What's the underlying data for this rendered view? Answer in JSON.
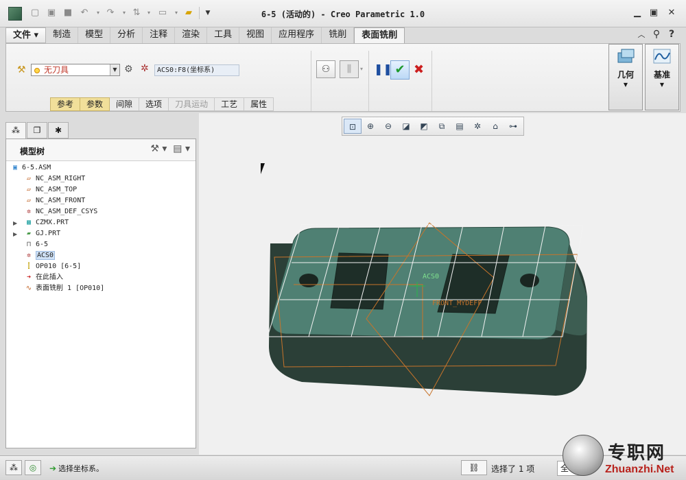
{
  "window": {
    "title": "6-5 (活动的) - Creo Parametric 1.0"
  },
  "ribbon_tabs": [
    {
      "label": "文件 ▾",
      "name": "tab-file"
    },
    {
      "label": "制造",
      "name": "tab-manufacture"
    },
    {
      "label": "模型",
      "name": "tab-model"
    },
    {
      "label": "分析",
      "name": "tab-analysis"
    },
    {
      "label": "注释",
      "name": "tab-annotate"
    },
    {
      "label": "渲染",
      "name": "tab-render"
    },
    {
      "label": "工具",
      "name": "tab-tools"
    },
    {
      "label": "视图",
      "name": "tab-view"
    },
    {
      "label": "应用程序",
      "name": "tab-applications"
    },
    {
      "label": "铣削",
      "name": "tab-milling"
    },
    {
      "label": "表面铣削",
      "name": "tab-face-milling"
    }
  ],
  "toolbar": {
    "tool_value": "无刀具",
    "coord_value": "ACS0:F8(坐标系)"
  },
  "subtabs": [
    {
      "label": "参考",
      "state": "hl"
    },
    {
      "label": "参数",
      "state": "hl"
    },
    {
      "label": "间隙",
      "state": "normal"
    },
    {
      "label": "选项",
      "state": "normal"
    },
    {
      "label": "刀具运动",
      "state": "disabled"
    },
    {
      "label": "工艺",
      "state": "normal"
    },
    {
      "label": "属性",
      "state": "normal"
    }
  ],
  "ribbon_groups": {
    "geometry_label": "几何",
    "datum_label": "基准"
  },
  "model_tree": {
    "title": "模型树",
    "items": [
      {
        "label": "6-5.ASM",
        "icon": "assembly-icon"
      },
      {
        "label": "NC_ASM_RIGHT",
        "icon": "datum-plane-icon"
      },
      {
        "label": "NC_ASM_TOP",
        "icon": "datum-plane-icon"
      },
      {
        "label": "NC_ASM_FRONT",
        "icon": "datum-plane-icon"
      },
      {
        "label": "NC_ASM_DEF_CSYS",
        "icon": "csys-icon"
      },
      {
        "label": "CZMX.PRT",
        "icon": "part-icon"
      },
      {
        "label": "GJ.PRT",
        "icon": "workpiece-icon"
      },
      {
        "label": "6-5",
        "icon": "workcell-icon"
      },
      {
        "label": "ACS0",
        "icon": "csys-icon"
      },
      {
        "label": "OP010 [6-5]",
        "icon": "operation-icon"
      },
      {
        "label": "在此插入",
        "icon": "insert-here-icon"
      },
      {
        "label": "表面铣削 1 [OP010]",
        "icon": "face-milling-icon"
      }
    ]
  },
  "viewport": {
    "csys_label": "ACS0",
    "datum_label": "FRONT_MYDEFF"
  },
  "status": {
    "message": "选择坐标系。",
    "selection": "选择了 1 项",
    "filter": "全"
  },
  "watermark": {
    "title": "专职网",
    "url": "Zhuanzhi.Net"
  }
}
